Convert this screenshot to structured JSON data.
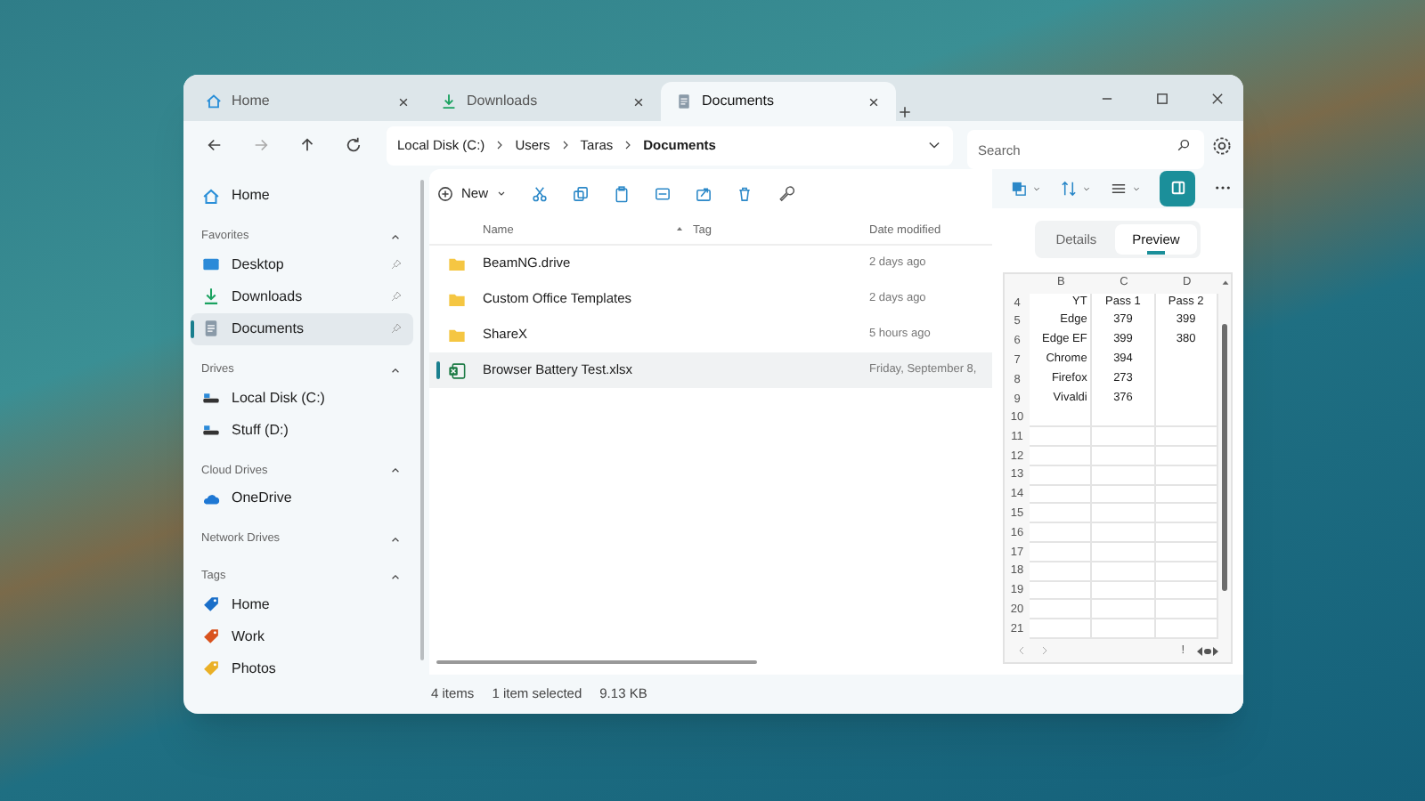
{
  "tabs": [
    {
      "label": "Home",
      "kind": "home",
      "selected": false
    },
    {
      "label": "Downloads",
      "kind": "download",
      "selected": false
    },
    {
      "label": "Documents",
      "kind": "document",
      "selected": true
    }
  ],
  "address": {
    "crumbs": [
      "Local Disk (C:)",
      "Users",
      "Taras",
      "Documents"
    ]
  },
  "search": {
    "placeholder": "Search"
  },
  "toolbar": {
    "new_label": "New"
  },
  "sidebar": {
    "home": "Home",
    "sections": [
      {
        "title": "Favorites",
        "items": [
          {
            "label": "Desktop",
            "kind": "desktop",
            "pinned": true,
            "selected": false
          },
          {
            "label": "Downloads",
            "kind": "download",
            "pinned": true,
            "selected": false
          },
          {
            "label": "Documents",
            "kind": "document",
            "pinned": true,
            "selected": true
          }
        ]
      },
      {
        "title": "Drives",
        "items": [
          {
            "label": "Local Disk (C:)",
            "kind": "drive",
            "pinned": false,
            "selected": false
          },
          {
            "label": "Stuff (D:)",
            "kind": "drive",
            "pinned": false,
            "selected": false
          }
        ]
      },
      {
        "title": "Cloud Drives",
        "items": [
          {
            "label": "OneDrive",
            "kind": "cloud",
            "pinned": false,
            "selected": false
          }
        ]
      },
      {
        "title": "Network Drives"
      },
      {
        "title": "Tags",
        "items": [
          {
            "label": "Home",
            "kind": "tag",
            "color": "#1a6fc9",
            "pinned": false,
            "selected": false
          },
          {
            "label": "Work",
            "kind": "tag",
            "color": "#d9531e",
            "pinned": false,
            "selected": false
          },
          {
            "label": "Photos",
            "kind": "tag",
            "color": "#eab026",
            "pinned": false,
            "selected": false
          }
        ]
      }
    ]
  },
  "table": {
    "columns": [
      "Name",
      "Tag",
      "Date modified"
    ],
    "rows": [
      {
        "kind": "folder",
        "name": "BeamNG.drive",
        "date": "2 days ago",
        "selected": false
      },
      {
        "kind": "folder",
        "name": "Custom Office Templates",
        "date": "2 days ago",
        "selected": false
      },
      {
        "kind": "folder",
        "name": "ShareX",
        "date": "5 hours ago",
        "selected": false
      },
      {
        "kind": "xlsx",
        "name": "Browser Battery Test.xlsx",
        "date": "Friday, September 8,",
        "selected": true
      }
    ]
  },
  "status_bar": [
    "4 items",
    "1 item selected",
    "9.13 KB"
  ],
  "preview": {
    "tabs": [
      {
        "label": "Details",
        "selected": false
      },
      {
        "label": "Preview",
        "selected": true
      }
    ],
    "sheet": {
      "columns": [
        "B",
        "C",
        "D"
      ],
      "rows": [
        {
          "n": "4",
          "cells": [
            "YT",
            "Pass 1",
            "Pass 2"
          ]
        },
        {
          "n": "5",
          "cells": [
            "Edge",
            "379",
            "399"
          ]
        },
        {
          "n": "6",
          "cells": [
            "Edge EF",
            "399",
            "380"
          ]
        },
        {
          "n": "7",
          "cells": [
            "Chrome",
            "394",
            ""
          ]
        },
        {
          "n": "8",
          "cells": [
            "Firefox",
            "273",
            ""
          ]
        },
        {
          "n": "9",
          "cells": [
            "Vivaldi",
            "376",
            ""
          ]
        },
        {
          "n": "10",
          "cells": [
            "",
            "",
            ""
          ]
        },
        {
          "n": "11",
          "cells": [
            "",
            "",
            ""
          ]
        },
        {
          "n": "12",
          "cells": [
            "",
            "",
            ""
          ]
        },
        {
          "n": "13",
          "cells": [
            "",
            "",
            ""
          ]
        },
        {
          "n": "14",
          "cells": [
            "",
            "",
            ""
          ]
        },
        {
          "n": "15",
          "cells": [
            "",
            "",
            ""
          ]
        },
        {
          "n": "16",
          "cells": [
            "",
            "",
            ""
          ]
        },
        {
          "n": "17",
          "cells": [
            "",
            "",
            ""
          ]
        },
        {
          "n": "18",
          "cells": [
            "",
            "",
            ""
          ]
        },
        {
          "n": "19",
          "cells": [
            "",
            "",
            ""
          ]
        },
        {
          "n": "20",
          "cells": [
            "",
            "",
            ""
          ]
        },
        {
          "n": "21",
          "cells": [
            "",
            "",
            ""
          ]
        }
      ],
      "footer_mark": "!"
    }
  }
}
